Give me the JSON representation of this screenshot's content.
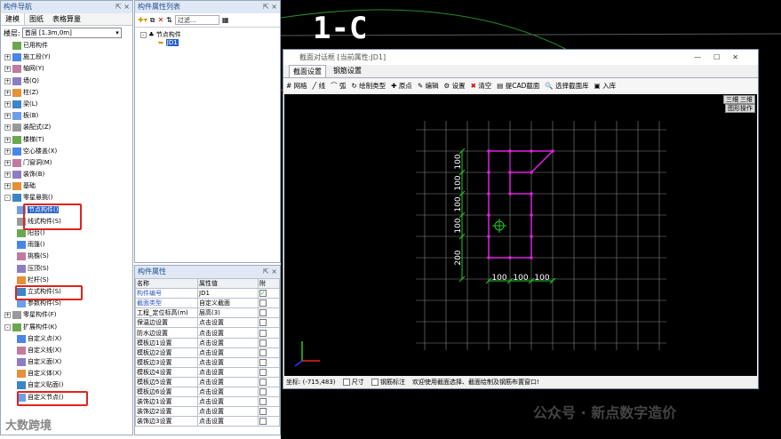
{
  "nav": {
    "title": "构件导航",
    "tabs": [
      "建模",
      "图纸",
      "表格算量"
    ],
    "floor_label": "楼层:",
    "floor_value": "首层 [1.3m,0m]",
    "items": [
      {
        "label": "已用构件",
        "indent": 0,
        "exp": ""
      },
      {
        "label": "施工段(Y)",
        "indent": 0,
        "exp": "+"
      },
      {
        "label": "轴网(Y)",
        "indent": 0,
        "exp": "+"
      },
      {
        "label": "墙(Q)",
        "indent": 0,
        "exp": "+"
      },
      {
        "label": "柱(Z)",
        "indent": 0,
        "exp": "+"
      },
      {
        "label": "梁(L)",
        "indent": 0,
        "exp": "+"
      },
      {
        "label": "板(B)",
        "indent": 0,
        "exp": "+"
      },
      {
        "label": "装配式(Z)",
        "indent": 0,
        "exp": "+"
      },
      {
        "label": "楼梯(T)",
        "indent": 0,
        "exp": "+"
      },
      {
        "label": "空心楼盖(X)",
        "indent": 0,
        "exp": "+"
      },
      {
        "label": "门窗洞(M)",
        "indent": 0,
        "exp": "+"
      },
      {
        "label": "装饰(B)",
        "indent": 0,
        "exp": "+"
      },
      {
        "label": "基础",
        "indent": 0,
        "exp": "+"
      },
      {
        "label": "零星悬挑()",
        "indent": 0,
        "exp": "-"
      },
      {
        "label": "节点构件()",
        "indent": 1,
        "exp": "",
        "hl": true
      },
      {
        "label": "线式构件(S)",
        "indent": 1,
        "exp": ""
      },
      {
        "label": "阳台()",
        "indent": 1,
        "exp": ""
      },
      {
        "label": "雨篷()",
        "indent": 1,
        "exp": ""
      },
      {
        "label": "挑檐(S)",
        "indent": 1,
        "exp": ""
      },
      {
        "label": "压顶(S)",
        "indent": 1,
        "exp": ""
      },
      {
        "label": "栏杆(S)",
        "indent": 1,
        "exp": ""
      },
      {
        "label": "立式构件(S)",
        "indent": 1,
        "exp": ""
      },
      {
        "label": "参数构件(S)",
        "indent": 1,
        "exp": ""
      },
      {
        "label": "零星构件(F)",
        "indent": 0,
        "exp": "+"
      },
      {
        "label": "扩展构件(K)",
        "indent": 0,
        "exp": "-"
      },
      {
        "label": "自定义点(X)",
        "indent": 1,
        "exp": ""
      },
      {
        "label": "自定义线(X)",
        "indent": 1,
        "exp": ""
      },
      {
        "label": "自定义面(X)",
        "indent": 1,
        "exp": ""
      },
      {
        "label": "自定义体(X)",
        "indent": 1,
        "exp": ""
      },
      {
        "label": "自定义贴面()",
        "indent": 1,
        "exp": ""
      },
      {
        "label": "自定义节点()",
        "indent": 1,
        "exp": ""
      }
    ]
  },
  "plist": {
    "title": "构件属性列表",
    "filter_placeholder": "过滤...",
    "root": "节点构件",
    "child": "JD1"
  },
  "pgrid": {
    "title": "构件属性",
    "headers": [
      "名称",
      "属性值",
      "附"
    ],
    "rows": [
      {
        "name": "构件编号",
        "value": "JD1",
        "blue": true,
        "checked": true
      },
      {
        "name": "截面类型",
        "value": "自定义截面",
        "blue": true,
        "checked": false
      },
      {
        "name": "工程_定位标高(m)",
        "value": "层高(3)",
        "blue": false,
        "checked": false
      },
      {
        "name": "保温边设置",
        "value": "点击设置",
        "blue": false,
        "checked": false
      },
      {
        "name": "防水边设置",
        "value": "点击设置",
        "blue": false,
        "checked": false
      },
      {
        "name": "模板边1设置",
        "value": "点击设置",
        "blue": false,
        "checked": false
      },
      {
        "name": "模板边2设置",
        "value": "点击设置",
        "blue": false,
        "checked": false
      },
      {
        "name": "模板边3设置",
        "value": "点击设置",
        "blue": false,
        "checked": false
      },
      {
        "name": "模板边4设置",
        "value": "点击设置",
        "blue": false,
        "checked": false
      },
      {
        "name": "模板边5设置",
        "value": "点击设置",
        "blue": false,
        "checked": false
      },
      {
        "name": "模板边6设置",
        "value": "点击设置",
        "blue": false,
        "checked": false
      },
      {
        "name": "装饰边1设置",
        "value": "点击设置",
        "blue": false,
        "checked": false
      },
      {
        "name": "装饰边2设置",
        "value": "点击设置",
        "blue": false,
        "checked": false
      },
      {
        "name": "装饰边3设置",
        "value": "点击设置",
        "blue": false,
        "checked": false
      }
    ]
  },
  "cad": {
    "label": "1-C"
  },
  "dialog": {
    "title": "截面对话框 [当前属性:JD1]",
    "tabs": [
      "截面设置",
      "钢筋设置"
    ],
    "tools": [
      "网格",
      "线",
      "弧",
      "绘制类型",
      "原点",
      "编辑",
      "设置",
      "清空",
      "提CAD截面",
      "选择截面库",
      "入库"
    ],
    "view_buttons": [
      "三维",
      "三维",
      "图形操作"
    ],
    "dims": {
      "left": [
        "100",
        "100",
        "100",
        "100",
        "200"
      ],
      "bottom": [
        "100",
        "100",
        "100"
      ]
    },
    "status": {
      "coord": "坐标: (-715,483)",
      "size": "尺寸",
      "rebar": "钢筋标注",
      "msg": "欢迎使用截面选择、截面绘制及钢筋布置窗口!"
    }
  },
  "watermark": {
    "left": "大数跨境",
    "right": "公众号 · 新点数字造价"
  }
}
